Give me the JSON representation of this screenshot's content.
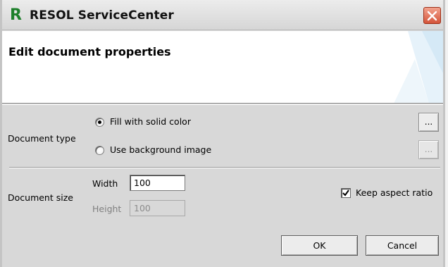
{
  "window": {
    "app_logo": "R",
    "app_title": "RESOL ServiceCenter",
    "close_icon": "close-icon"
  },
  "header": {
    "title": "Edit document properties"
  },
  "document_type": {
    "label": "Document type",
    "fill_option": {
      "label": "Fill with solid color",
      "checked": true
    },
    "background_option": {
      "label": "Use background image",
      "checked": false
    },
    "fill_browse_label": "...",
    "background_browse_label": "..."
  },
  "document_size": {
    "label": "Document size",
    "width_label": "Width",
    "width_value": "100",
    "height_label": "Height",
    "height_value": "100",
    "keep_aspect_label": "Keep aspect ratio",
    "keep_aspect_checked": true
  },
  "buttons": {
    "ok_label": "OK",
    "cancel_label": "Cancel"
  },
  "colors": {
    "logo_green": "#1d7f2a",
    "close_red": "#d4543a",
    "panel_gray": "#d8d8d8"
  }
}
